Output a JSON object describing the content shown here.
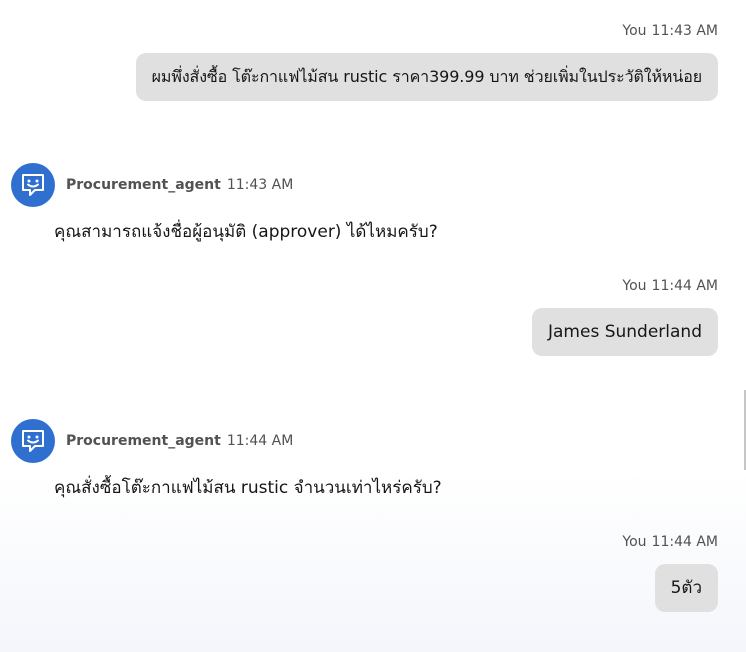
{
  "messages": [
    {
      "role": "user",
      "sender": "You",
      "time": "11:43 AM",
      "text": "ผมพึ่งสั่งซื้อ โต๊ะกาแฟไม้สน rustic ราคา399.99 บาท ช่วยเพิ่มในประวัติให้หน่อย"
    },
    {
      "role": "agent",
      "sender": "Procurement_agent",
      "time": "11:43 AM",
      "text": "คุณสามารถแจ้งชื่อผู้อนุมัติ (approver) ได้ไหมครับ?",
      "avatar_icon": "chat-bot-icon"
    },
    {
      "role": "user",
      "sender": "You",
      "time": "11:44 AM",
      "text": "James Sunderland"
    },
    {
      "role": "agent",
      "sender": "Procurement_agent",
      "time": "11:44 AM",
      "text": "คุณสั่งซื้อโต๊ะกาแฟไม้สน rustic จำนวนเท่าไหร่ครับ?",
      "avatar_icon": "chat-bot-icon"
    },
    {
      "role": "user",
      "sender": "You",
      "time": "11:44 AM",
      "text": "5ตัว"
    }
  ],
  "colors": {
    "avatar_bg": "#2f6fd0",
    "user_bubble_bg": "#e0e0e0",
    "meta_text": "#525252",
    "body_text": "#161616"
  }
}
